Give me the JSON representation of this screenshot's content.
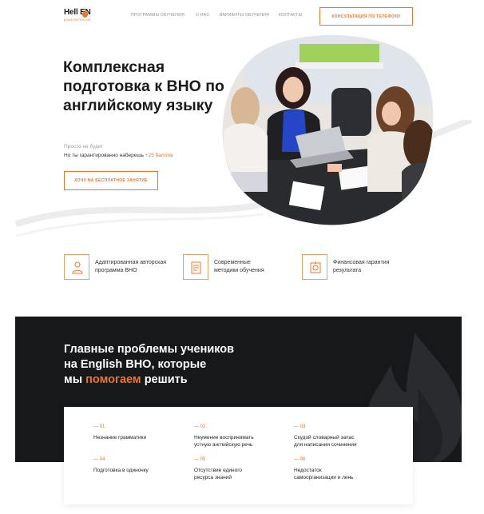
{
  "header": {
    "logo": {
      "main": "Hell EN",
      "sub": "ДОМА ИНТЕНСИВ"
    },
    "nav": [
      {
        "label": "ПРОГРАММЫ ОБУЧЕНИЯ"
      },
      {
        "label": "О НАС"
      },
      {
        "label": "ВАРИАНТЫ ОБУЧЕНИЯ"
      },
      {
        "label": "КОНТАКТЫ"
      }
    ],
    "cta_label": "КОНСУЛЬТАЦИЯ ПО ТЕЛЕФОНУ"
  },
  "hero": {
    "title": "Комплексная подготовка к ВНО по английскому языку",
    "subtitle1": "Просто не будет",
    "subtitle2_prefix": "Но ты гарантированно наберешь ",
    "subtitle2_accent": "+25 баллов",
    "cta_label": "ХОЧУ НА БЕСПЛАТНОЕ ЗАНЯТИЕ"
  },
  "features": [
    {
      "line1": "Адаптированная авторская",
      "line2": "программа ВНО",
      "icon": "teacher-icon"
    },
    {
      "line1": "Современные",
      "line2": "методики обучения",
      "icon": "document-icon"
    },
    {
      "line1": "Финансовая гарантия",
      "line2": "результата",
      "icon": "guarantee-icon"
    }
  ],
  "problems_section": {
    "title_line1": "Главные проблемы учеников",
    "title_line2": "на English ВНО, которые",
    "title_line3_prefix": "мы ",
    "title_line3_accent": "помогаем",
    "title_line3_suffix": " решить",
    "items": [
      {
        "num": "— 01",
        "line1": "Незнание грамматики",
        "line2": ""
      },
      {
        "num": "— 02",
        "line1": "Неумение воспринимать",
        "line2": "устную английскую речь"
      },
      {
        "num": "— 03",
        "line1": "Скудой словарный запас",
        "line2": "для написании сочинения"
      },
      {
        "num": "— 04",
        "line1": "Подготовка в одиночку",
        "line2": ""
      },
      {
        "num": "— 05",
        "line1": "Отсутствие единого",
        "line2": "ресурса знаний"
      },
      {
        "num": "— 06",
        "line1": "Недостаток",
        "line2": "самоорганизации и лень"
      }
    ]
  },
  "colors": {
    "accent": "#e8772e",
    "dark": "#17181a",
    "text": "#1b1b1b"
  }
}
